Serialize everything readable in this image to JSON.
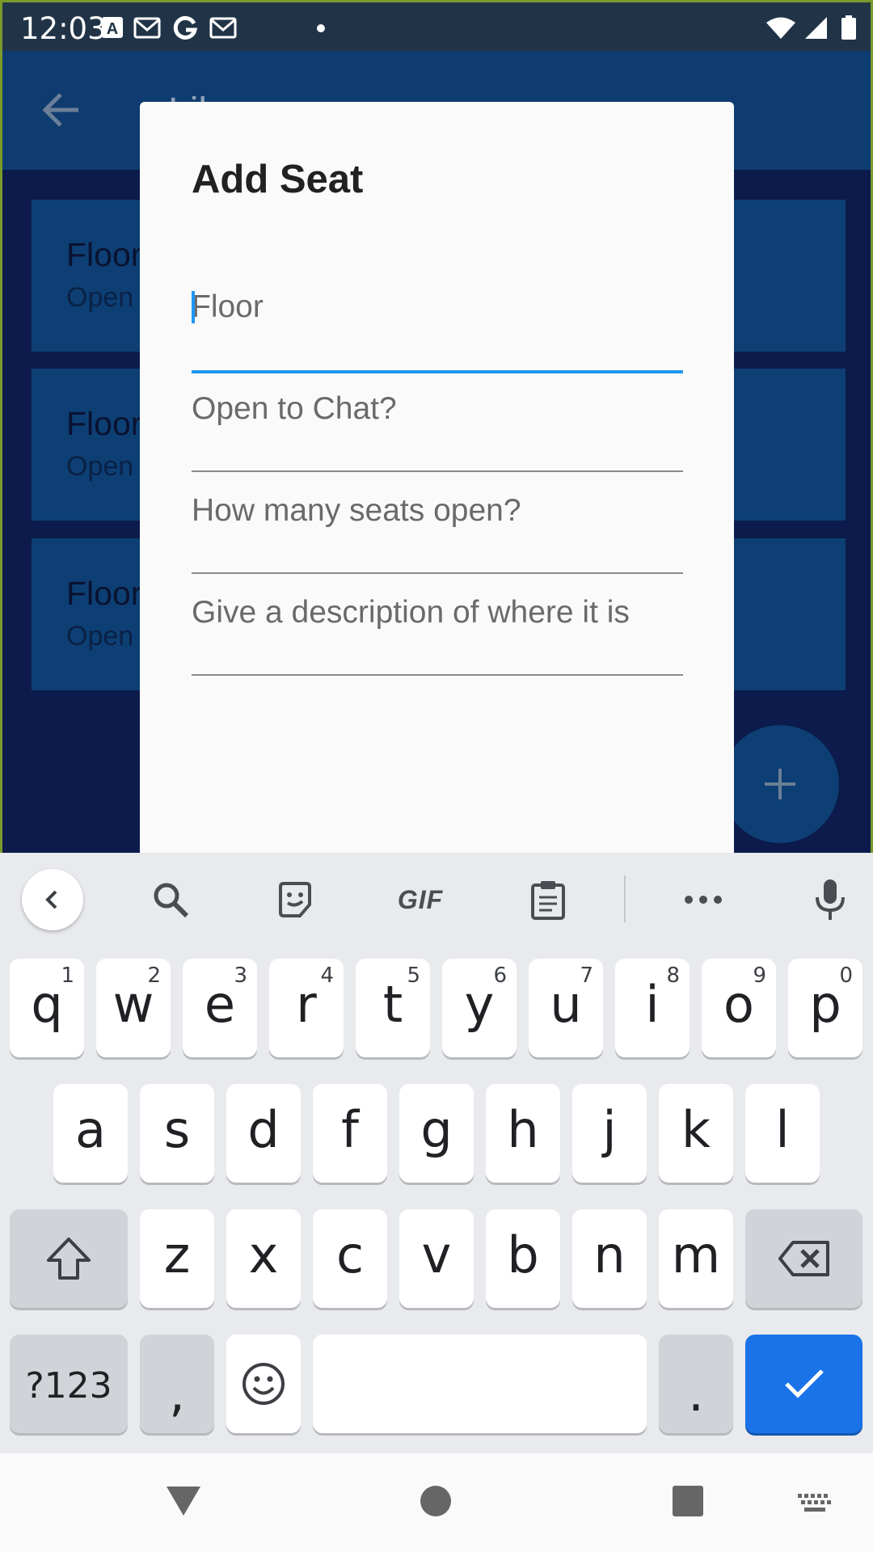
{
  "status_bar": {
    "time": "12:03",
    "icons": [
      "font-a-icon",
      "gmail-icon",
      "google-icon",
      "gmail-icon",
      "notification-dot",
      "wifi-icon",
      "signal-icon",
      "battery-icon"
    ]
  },
  "app_bar": {
    "title": "Lil",
    "back_icon": "arrow-back-icon"
  },
  "seat_list": [
    {
      "floor": "Floor",
      "open": "Open"
    },
    {
      "floor": "Floor",
      "open": "Open"
    },
    {
      "floor": "Floor",
      "open": "Open"
    }
  ],
  "fab": {
    "icon": "plus-icon"
  },
  "dialog": {
    "title": "Add Seat",
    "fields": [
      {
        "placeholder": "Floor",
        "value": ""
      },
      {
        "placeholder": "Open to Chat?",
        "value": ""
      },
      {
        "placeholder": "How many seats open?",
        "value": ""
      },
      {
        "placeholder": "Give a description of where it is",
        "value": ""
      }
    ]
  },
  "keyboard": {
    "toolbar": {
      "gif_label": "GIF"
    },
    "row1": [
      {
        "key": "q",
        "hint": "1"
      },
      {
        "key": "w",
        "hint": "2"
      },
      {
        "key": "e",
        "hint": "3"
      },
      {
        "key": "r",
        "hint": "4"
      },
      {
        "key": "t",
        "hint": "5"
      },
      {
        "key": "y",
        "hint": "6"
      },
      {
        "key": "u",
        "hint": "7"
      },
      {
        "key": "i",
        "hint": "8"
      },
      {
        "key": "o",
        "hint": "9"
      },
      {
        "key": "p",
        "hint": "0"
      }
    ],
    "row2": [
      "a",
      "s",
      "d",
      "f",
      "g",
      "h",
      "j",
      "k",
      "l"
    ],
    "row3": [
      "z",
      "x",
      "c",
      "v",
      "b",
      "n",
      "m"
    ],
    "row4": {
      "symbols": "?123",
      "comma": ",",
      "period": "."
    }
  },
  "colors": {
    "accent": "#2196f3",
    "keyboard_action": "#1a73e8",
    "app_bar": "#0f3c70",
    "scrim_body": "#0c1b4b"
  }
}
